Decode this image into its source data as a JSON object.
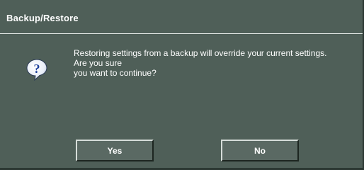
{
  "dialog": {
    "title": "Backup/Restore",
    "icon": "question-icon",
    "message_lines": [
      "Restoring settings from a backup will override your current settings.",
      "Are you sure",
      "you want to continue?"
    ],
    "buttons": {
      "yes": "Yes",
      "no": "No"
    }
  },
  "colors": {
    "background": "#4f5f58",
    "text": "#ffffff",
    "icon_blue": "#1b3f9a"
  }
}
